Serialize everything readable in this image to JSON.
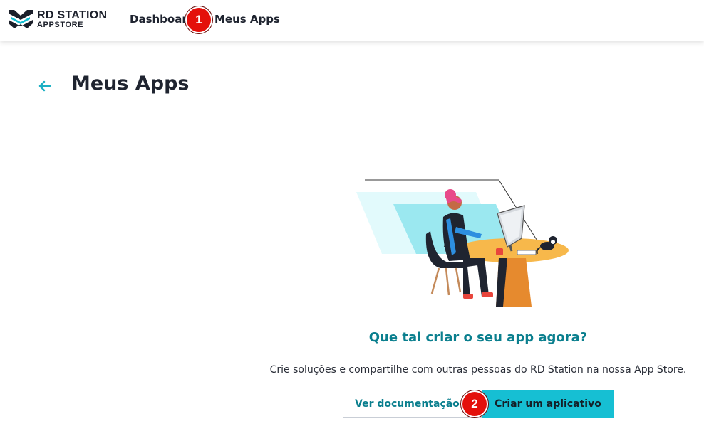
{
  "header": {
    "brand_name": "RD STATION",
    "brand_sub": "APPSTORE",
    "nav": [
      {
        "label": "Dashboard"
      },
      {
        "label": "Meus Apps"
      }
    ]
  },
  "annotations": {
    "badge_1": "1",
    "badge_2": "2"
  },
  "page": {
    "back_icon": "arrow-left-icon",
    "title": "Meus Apps"
  },
  "empty_state": {
    "illustration": "woman-at-desk-with-cat-illustration",
    "heading": "Que tal criar o seu app agora?",
    "description": "Crie soluções e compartilhe com outras pessoas do RD Station na nossa App Store.",
    "secondary_button": "Ver documentação",
    "primary_button": "Criar um aplicativo"
  },
  "colors": {
    "accent": "#16bfd3",
    "accent_text": "#0a7f8e",
    "badge": "#e4100b",
    "text": "#1f2430"
  }
}
